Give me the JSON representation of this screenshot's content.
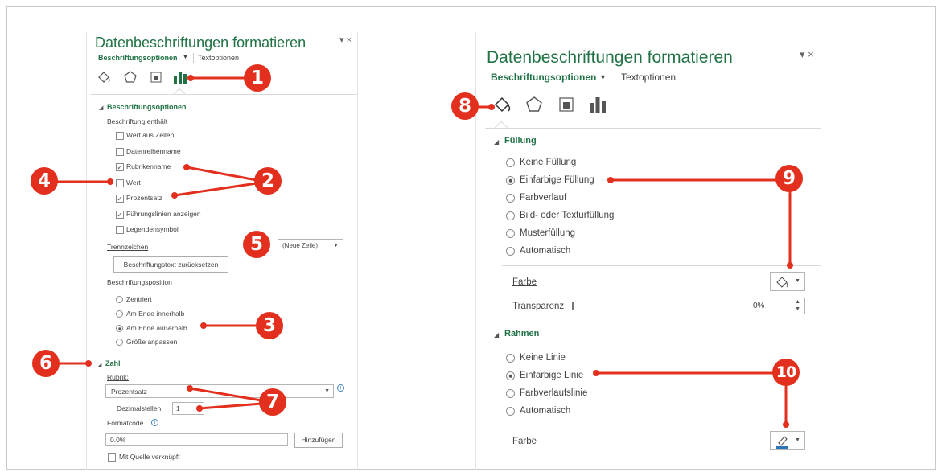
{
  "left": {
    "pane_title": "Datenbeschriftungen formatieren",
    "pane_controls": "▾ ×",
    "tab_active": "Beschriftungsoptionen",
    "tab_dropdown": "▼",
    "tab_other": "Textoptionen",
    "icons": [
      "fill-line-icon",
      "effects-pentagon-icon",
      "size-properties-icon",
      "label-options-bar-icon"
    ],
    "section_title": "Beschriftungsoptionen",
    "label_contains": "Beschriftung enthält",
    "checkboxes": [
      {
        "label": "Wert aus Zellen",
        "checked": false
      },
      {
        "label": "Datenreihenname",
        "checked": false
      },
      {
        "label": "Rubrikenname",
        "checked": true
      },
      {
        "label": "Wert",
        "checked": false
      },
      {
        "label": "Prozentsatz",
        "checked": true
      },
      {
        "label": "Führungslinien anzeigen",
        "checked": true
      },
      {
        "label": "Legendensymbol",
        "checked": false
      }
    ],
    "separator_label": "Trennzeichen",
    "separator_value": "(Neue Zeile)",
    "reset_button": "Beschriftungstext zurücksetzen",
    "position_label": "Beschriftungsposition",
    "positions": [
      {
        "label": "Zentriert",
        "selected": false
      },
      {
        "label": "Am Ende innerhalb",
        "selected": false
      },
      {
        "label": "Am Ende außerhalb",
        "selected": true
      },
      {
        "label": "Größe anpassen",
        "selected": false
      }
    ],
    "number_section": "Zahl",
    "category_label": "Rubrik:",
    "category_value": "Prozentsatz",
    "decimals_label": "Dezimalstellen:",
    "decimals_value": "1",
    "format_code_label": "Formatcode",
    "format_code_value": "0.0%",
    "add_button": "Hinzufügen",
    "link_source": "Mit Quelle verknüpft"
  },
  "right": {
    "pane_title": "Datenbeschriftungen formatieren",
    "pane_controls": "▾ ×",
    "tab_active": "Beschriftungsoptionen",
    "tab_dropdown": "▼",
    "tab_other": "Textoptionen",
    "icons": [
      "fill-line-icon",
      "effects-pentagon-icon",
      "size-properties-icon",
      "label-options-bar-icon"
    ],
    "fill_section": "Füllung",
    "fill_options": [
      {
        "label": "Keine Füllung",
        "selected": false
      },
      {
        "label": "Einfarbige Füllung",
        "selected": true
      },
      {
        "label": "Farbverlauf",
        "selected": false
      },
      {
        "label": "Bild- oder Texturfüllung",
        "selected": false
      },
      {
        "label": "Musterfüllung",
        "selected": false
      },
      {
        "label": "Automatisch",
        "selected": false
      }
    ],
    "color_label": "Farbe",
    "transparency_label": "Transparenz",
    "transparency_value": "0%",
    "border_section": "Rahmen",
    "border_options": [
      {
        "label": "Keine Linie",
        "selected": false
      },
      {
        "label": "Einfarbige Linie",
        "selected": true
      },
      {
        "label": "Farbverlaufslinie",
        "selected": false
      },
      {
        "label": "Automatisch",
        "selected": false
      }
    ],
    "border_color_label": "Farbe"
  },
  "callouts": [
    "1",
    "2",
    "3",
    "4",
    "5",
    "6",
    "7",
    "8",
    "9",
    "10"
  ],
  "colors": {
    "accent_green": "#217346",
    "callout_red": "#e3301e",
    "border_blue": "#2e75b6"
  }
}
